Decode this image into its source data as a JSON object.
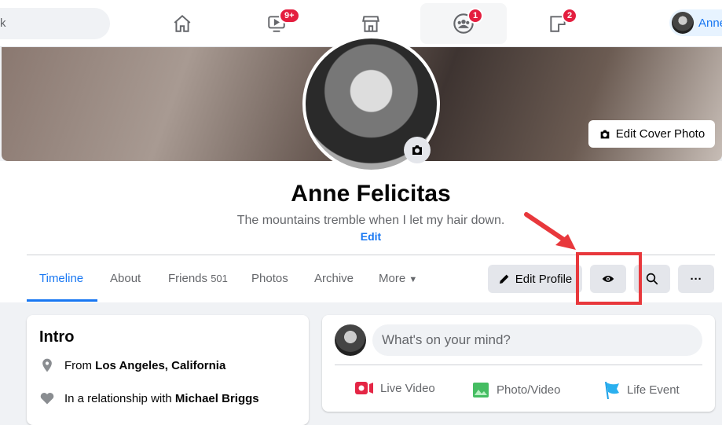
{
  "topbar": {
    "search_text": "k",
    "badges": {
      "watch": "9+",
      "groups": "1",
      "gaming": "2"
    },
    "user_short": "Anne"
  },
  "profile": {
    "name": "Anne Felicitas",
    "bio": "The mountains tremble when I let my hair down.",
    "edit_label": "Edit",
    "edit_cover_label": "Edit Cover Photo"
  },
  "tabs": [
    {
      "label": "Timeline"
    },
    {
      "label": "About"
    },
    {
      "label": "Friends",
      "count": "501"
    },
    {
      "label": "Photos"
    },
    {
      "label": "Archive"
    },
    {
      "label": "More"
    }
  ],
  "actions": {
    "edit_profile": "Edit Profile"
  },
  "intro": {
    "title": "Intro",
    "from_prefix": "From",
    "from": "Los Angeles, California",
    "rel_prefix": "In a relationship with",
    "rel": "Michael Briggs"
  },
  "composer": {
    "placeholder": "What's on your mind?",
    "live": "Live Video",
    "photo": "Photo/Video",
    "life": "Life Event"
  },
  "colors": {
    "accent": "#1877f2",
    "badge": "#e41e3f",
    "highlight": "#e8383c"
  }
}
